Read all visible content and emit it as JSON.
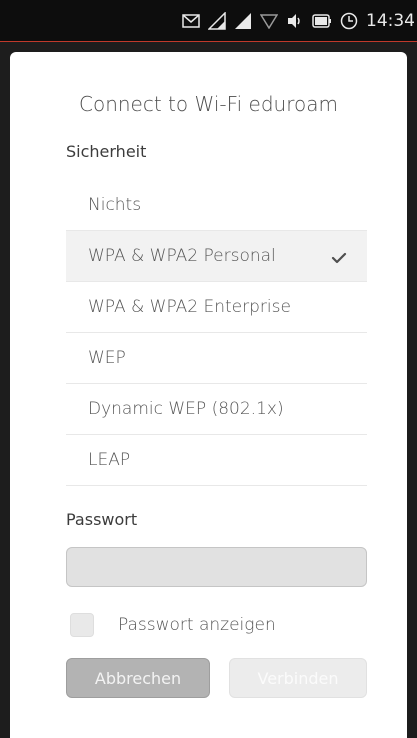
{
  "statusbar": {
    "time": "14:34",
    "icons": [
      "mail-icon",
      "signal-icon",
      "signal-icon",
      "wifi-icon",
      "volume-icon",
      "battery-icon",
      "clock-icon"
    ],
    "accent_line_color": "#c0392b"
  },
  "dialog": {
    "title": "Connect to Wi-Fi eduroam",
    "security_label": "Sicherheit",
    "security_options": [
      {
        "label": "Nichts",
        "selected": false
      },
      {
        "label": "WPA & WPA2 Personal",
        "selected": true
      },
      {
        "label": "WPA & WPA2 Enterprise",
        "selected": false
      },
      {
        "label": "WEP",
        "selected": false
      },
      {
        "label": "Dynamic WEP (802.1x)",
        "selected": false
      },
      {
        "label": "LEAP",
        "selected": false
      }
    ],
    "password_label": "Passwort",
    "password_value": "",
    "show_password_label": "Passwort anzeigen",
    "show_password_checked": false,
    "cancel_label": "Abbrechen",
    "connect_label": "Verbinden",
    "connect_enabled": false
  }
}
